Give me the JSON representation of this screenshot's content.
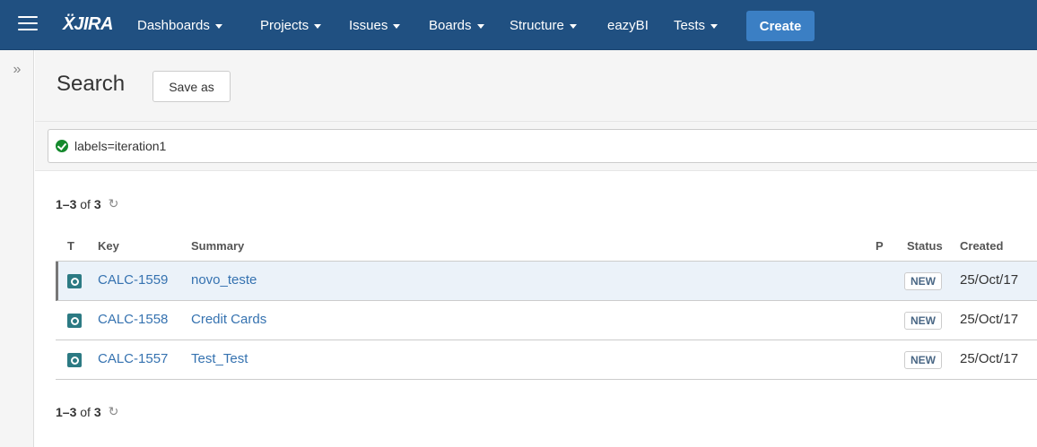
{
  "nav": {
    "logo_mark": "Ẍ",
    "logo_text": "JIRA",
    "items": [
      {
        "label": "Dashboards"
      },
      {
        "label": "Projects"
      },
      {
        "label": "Issues"
      },
      {
        "label": "Boards"
      },
      {
        "label": "Structure"
      },
      {
        "label": "eazyBI"
      },
      {
        "label": "Tests"
      }
    ],
    "create_label": "Create"
  },
  "sidebar": {
    "expand_glyph": "»"
  },
  "page": {
    "title": "Search",
    "save_as_label": "Save as"
  },
  "query": {
    "text": "labels=iteration1"
  },
  "results": {
    "range": "1–3",
    "of": "of",
    "total": "3"
  },
  "table": {
    "columns": {
      "t": "T",
      "key": "Key",
      "summary": "Summary",
      "p": "P",
      "status": "Status",
      "created": "Created"
    },
    "rows": [
      {
        "key": "CALC-1559",
        "summary": "novo_teste",
        "status": "NEW",
        "created": "25/Oct/17"
      },
      {
        "key": "CALC-1558",
        "summary": "Credit Cards",
        "status": "NEW",
        "created": "25/Oct/17"
      },
      {
        "key": "CALC-1557",
        "summary": "Test_Test",
        "status": "NEW",
        "created": "25/Oct/17"
      }
    ]
  },
  "colors": {
    "topbar": "#205081",
    "create": "#3b7fc4",
    "link": "#3572b0",
    "success": "#14892c",
    "type_icon": "#2c7a83"
  },
  "icons": {
    "menu": "hamburger-icon",
    "check": "check-circle-icon",
    "refresh": "refresh-icon",
    "type": "issue-type-icon",
    "expand": "expand-sidebar-icon"
  }
}
